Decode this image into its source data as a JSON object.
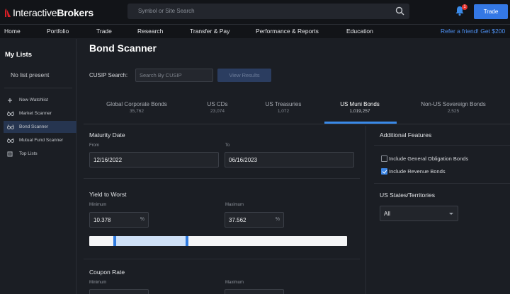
{
  "header": {
    "brand_light": "Interactive",
    "brand_bold": "Brokers",
    "search_placeholder": "Symbol or Site Search",
    "notification_count": "1",
    "trade_label": "Trade"
  },
  "nav": {
    "items": [
      "Home",
      "Portfolio",
      "Trade",
      "Research",
      "Transfer & Pay",
      "Performance & Reports",
      "Education"
    ],
    "refer": "Refer a friend! Get $200"
  },
  "sidebar": {
    "title": "My Lists",
    "empty": "No list present",
    "items": [
      {
        "label": "New Watchlist",
        "icon": "plus-icon",
        "active": false
      },
      {
        "label": "Market Scanner",
        "icon": "binoculars-icon",
        "active": false
      },
      {
        "label": "Bond Scanner",
        "icon": "binoculars-icon",
        "active": true
      },
      {
        "label": "Mutual Fund Scanner",
        "icon": "binoculars-icon",
        "active": false
      },
      {
        "label": "Top Lists",
        "icon": "list-icon",
        "active": false
      }
    ]
  },
  "page": {
    "title": "Bond Scanner",
    "cusip_label": "CUSIP Search:",
    "cusip_placeholder": "Search By CUSIP",
    "view_results": "View Results"
  },
  "tabs": [
    {
      "label": "Global Corporate Bonds",
      "count": "35,762",
      "active": false
    },
    {
      "label": "US CDs",
      "count": "23,074",
      "active": false
    },
    {
      "label": "US Treasuries",
      "count": "1,072",
      "active": false
    },
    {
      "label": "US Muni Bonds",
      "count": "1,019,257",
      "active": true
    },
    {
      "label": "Non-US Sovereign Bonds",
      "count": "2,525",
      "active": false
    }
  ],
  "maturity": {
    "title": "Maturity Date",
    "from_label": "From",
    "to_label": "To",
    "from_value": "12/16/2022",
    "to_value": "06/16/2023"
  },
  "yield": {
    "title": "Yield to Worst",
    "min_label": "Minimum",
    "max_label": "Maximum",
    "min_value": "10.378",
    "max_value": "37.562",
    "unit": "%",
    "range_start_fraction": 0.1,
    "range_end_fraction": 0.38
  },
  "coupon": {
    "title": "Coupon Rate",
    "min_label": "Minimum",
    "max_label": "Maximum"
  },
  "additional": {
    "title": "Additional Features",
    "go_bonds": {
      "label": "Include General Obligation Bonds",
      "checked": false
    },
    "revenue_bonds": {
      "label": "Include Revenue Bonds",
      "checked": true
    },
    "states_title": "US States/Territories",
    "states_value": "All"
  },
  "colors": {
    "accent": "#3478e5",
    "active_tab_underline": "#3a8ae8",
    "background": "#1b1e24",
    "topbar": "#121418"
  }
}
